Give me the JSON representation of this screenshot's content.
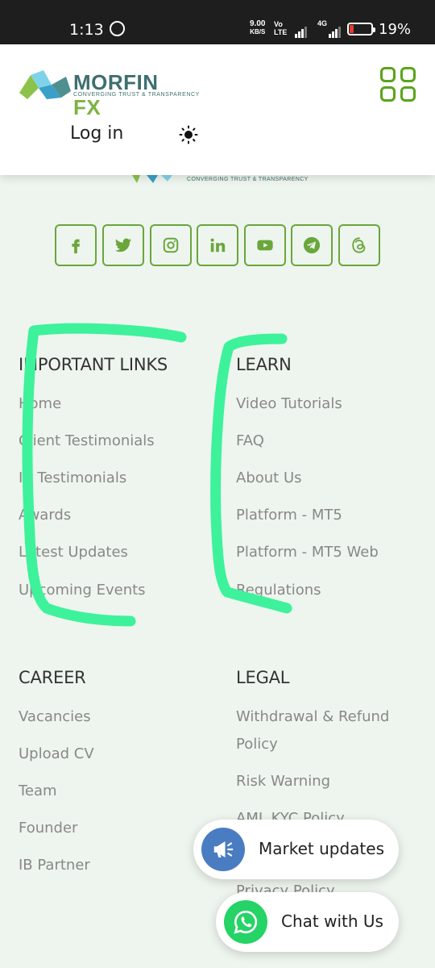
{
  "status_bar": {
    "time": "1:13",
    "net_speed_value": "9.00",
    "net_speed_unit": "KB/S",
    "volte_top": "Vo",
    "volte_bottom": "LTE",
    "network_type": "4G",
    "battery_percent": "19%"
  },
  "header": {
    "brand_main": "MORFIN",
    "brand_accent": "FX",
    "tagline": "CONVERGING TRUST & TRANSPARENCY",
    "login_label": "Log in"
  },
  "footer_logo": {
    "tagline": "CONVERGING TRUST & TRANSPARENCY"
  },
  "social": [
    "facebook",
    "twitter",
    "instagram",
    "linkedin",
    "youtube",
    "telegram",
    "threads"
  ],
  "important_links": {
    "title": "IMPORTANT LINKS",
    "items": [
      "Home",
      "Client Testimonials",
      "IB Testimonials",
      "Awards",
      "Latest Updates",
      "Upcoming Events"
    ]
  },
  "learn": {
    "title": "LEARN",
    "items": [
      "Video Tutorials",
      "FAQ",
      "About Us",
      "Platform - MT5",
      "Platform - MT5 Web",
      "Regulations"
    ]
  },
  "career": {
    "title": "CAREER",
    "items": [
      "Vacancies",
      "Upload CV",
      "Team",
      "Founder",
      "IB Partner"
    ]
  },
  "legal": {
    "title": "LEGAL",
    "items": [
      "Withdrawal & Refund",
      "Policy",
      "Risk Warning",
      "AML KYC Policy",
      "Privacy Policy"
    ]
  },
  "floating": {
    "market_updates": "Market updates",
    "chat": "Chat with Us"
  },
  "colors": {
    "accent_green": "#6aa63c",
    "annotation_green": "#3df29b",
    "megaphone_blue": "#4a7cc2",
    "whatsapp_green": "#25d366"
  }
}
